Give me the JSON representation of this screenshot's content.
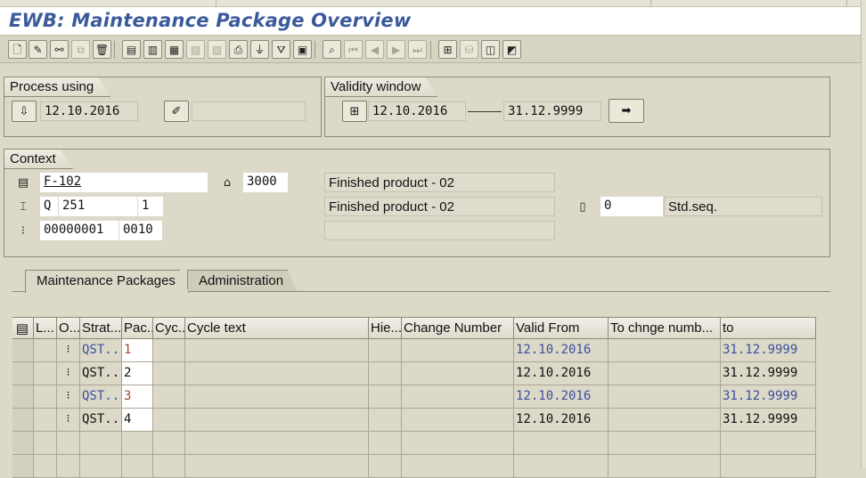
{
  "window": {
    "title": "EWB: Maintenance Package Overview"
  },
  "toolbar": {
    "buttons": [
      {
        "name": "create-icon",
        "glyph": "🗋",
        "enabled": true
      },
      {
        "name": "edit-icon",
        "glyph": "✎",
        "enabled": true
      },
      {
        "name": "display-toggle-icon",
        "glyph": "⚯",
        "enabled": true
      },
      {
        "name": "copy-icon",
        "glyph": "⧉",
        "enabled": false
      },
      {
        "name": "delete-icon",
        "glyph": "🗑",
        "enabled": true
      },
      {
        "name": "select-all-icon",
        "glyph": "▤",
        "enabled": true
      },
      {
        "name": "select-block-icon",
        "glyph": "▥",
        "enabled": true
      },
      {
        "name": "deselect-icon",
        "glyph": "▦",
        "enabled": true
      },
      {
        "name": "details-icon",
        "glyph": "▧",
        "enabled": false
      },
      {
        "name": "choose-icon",
        "glyph": "▨",
        "enabled": false
      },
      {
        "name": "print-icon",
        "glyph": "⎙",
        "enabled": true
      },
      {
        "name": "filter-icon",
        "glyph": "⏚",
        "enabled": true
      },
      {
        "name": "set-filter-icon",
        "glyph": "⛛",
        "enabled": true
      },
      {
        "name": "sort-icon",
        "glyph": "▣",
        "enabled": true
      },
      {
        "name": "find-icon",
        "glyph": "⌕",
        "enabled": true
      },
      {
        "name": "first-page-icon",
        "glyph": "⏮",
        "enabled": false
      },
      {
        "name": "previous-page-icon",
        "glyph": "◀",
        "enabled": false
      },
      {
        "name": "next-page-icon",
        "glyph": "▶",
        "enabled": false
      },
      {
        "name": "last-page-icon",
        "glyph": "⏭",
        "enabled": false
      },
      {
        "name": "hierarchy-icon",
        "glyph": "⊞",
        "enabled": true
      },
      {
        "name": "graphic-icon",
        "glyph": "⛁",
        "enabled": false
      },
      {
        "name": "overview-icon",
        "glyph": "◫",
        "enabled": true
      },
      {
        "name": "info-icon",
        "glyph": "◩",
        "enabled": true
      }
    ]
  },
  "process_using": {
    "label": "Process using",
    "date": "12.10.2016",
    "extra_value": ""
  },
  "validity_window": {
    "label": "Validity window",
    "from": "12.10.2016",
    "to": "31.12.9999"
  },
  "context": {
    "label": "Context",
    "material": "F-102",
    "plant": "3000",
    "material_desc": "Finished product - 02",
    "task_list_type": "Q",
    "group": "251",
    "group_counter": "1",
    "task_list_desc": "Finished product - 02",
    "sequence": "0",
    "sequence_desc": "Std.seq.",
    "node_id": "00000001",
    "operation": "0010",
    "empty_desc": ""
  },
  "tabs": [
    {
      "label": "Maintenance Packages",
      "active": true
    },
    {
      "label": "Administration",
      "active": false
    }
  ],
  "table": {
    "headers": [
      "",
      "L...",
      "O...",
      "Strat...",
      "Pac...",
      "Cyc...",
      "Cycle text",
      "Hie...",
      "Change Number",
      "Valid From",
      "To chnge numb...",
      "to"
    ],
    "rows": [
      {
        "strategy": "QST...",
        "package": "1",
        "valid_from": "12.10.2016",
        "to": "31.12.9999",
        "color": "blue"
      },
      {
        "strategy": "QST...",
        "package": "2",
        "valid_from": "12.10.2016",
        "to": "31.12.9999",
        "color": "black"
      },
      {
        "strategy": "QST...",
        "package": "3",
        "valid_from": "12.10.2016",
        "to": "31.12.9999",
        "color": "blue"
      },
      {
        "strategy": "QST...",
        "package": "4",
        "valid_from": "12.10.2016",
        "to": "31.12.9999",
        "color": "black"
      }
    ]
  }
}
